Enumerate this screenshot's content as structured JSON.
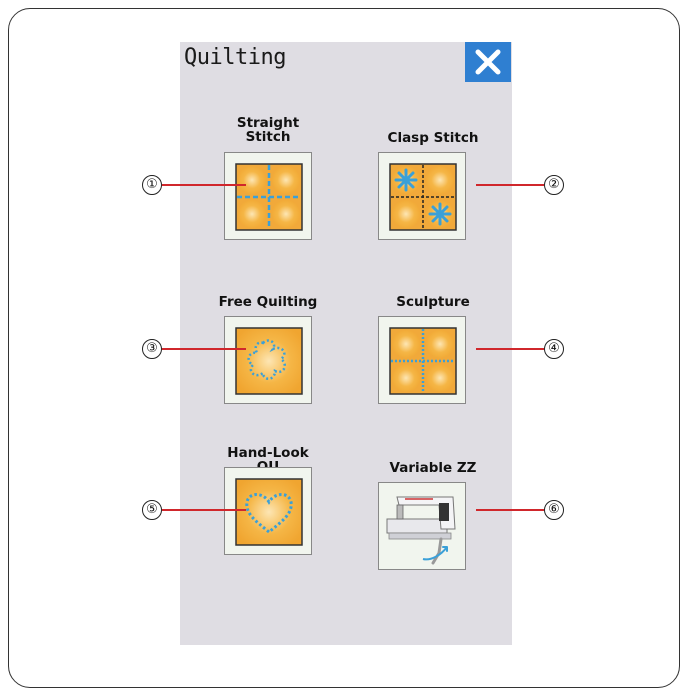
{
  "panel": {
    "title": "Quilting",
    "close_icon": "close-x-icon"
  },
  "buttons": [
    {
      "label": "Straight\nStitch",
      "number": "①",
      "icon": "straight-stitch-quilt-icon"
    },
    {
      "label": "Clasp Stitch",
      "number": "②",
      "icon": "clasp-stitch-quilt-icon"
    },
    {
      "label": "Free Quilting",
      "number": "③",
      "icon": "free-quilting-icon"
    },
    {
      "label": "Sculpture",
      "number": "④",
      "icon": "sculpture-quilt-icon"
    },
    {
      "label": "Hand-Look\nQU",
      "number": "⑤",
      "icon": "hand-look-heart-icon"
    },
    {
      "label": "Variable ZZ",
      "number": "⑥",
      "icon": "sewing-machine-knee-lifter-icon"
    }
  ],
  "colors": {
    "close_bg": "#2f7fd1",
    "quilt_fill": "#f1a93a",
    "stitch": "#3aa0d8",
    "callout_line": "#d0272c",
    "panel_bg": "#dfdde3"
  }
}
